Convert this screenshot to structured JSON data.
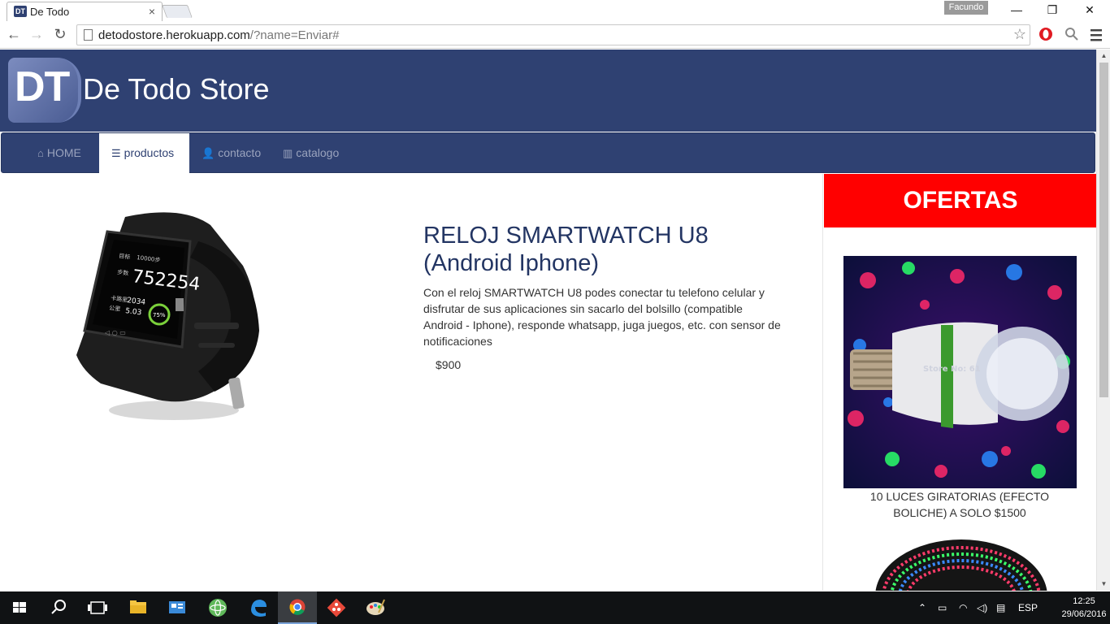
{
  "browser": {
    "tab_title": "De Todo",
    "tab_favicon": "DT",
    "tab_close": "×",
    "profile_name": "Facundo",
    "url_host": "detodostore.herokuapp.com",
    "url_path": "/?name=Enviar#",
    "window_controls": {
      "minimize": "—",
      "maximize": "❐",
      "close": "✕"
    }
  },
  "site": {
    "logo_text": "DT",
    "title": "De Todo Store",
    "nav": [
      {
        "label": "HOME",
        "icon": "home-icon",
        "active": false
      },
      {
        "label": "productos",
        "icon": "list-icon",
        "active": true
      },
      {
        "label": "contacto",
        "icon": "user-icon",
        "active": false
      },
      {
        "label": "catalogo",
        "icon": "barcode-icon",
        "active": false
      }
    ]
  },
  "product": {
    "title": "RELOJ SMARTWATCH U8 (Android Iphone)",
    "description": "Con el reloj SMARTWATCH U8 podes conectar tu telefono celular y disfrutar de sus aplicaciones sin sacarlo del bolsillo (compatible Android - Iphone), responde whatsapp, juga juegos, etc. con sensor de notificaciones",
    "price": "$900",
    "watch_screen": {
      "label1": "目标",
      "value1": "10000步",
      "label2": "步数",
      "steps": "752254",
      "label3": "卡路里",
      "value3": "2034",
      "label4": "公里",
      "value4": "5.03",
      "percent": "75%"
    }
  },
  "offers": {
    "heading": "OFERTAS",
    "items": [
      {
        "caption": "10 LUCES GIRATORIAS (EFECTO BOLICHE) A SOLO $1500",
        "watermark": "Store No: 61"
      }
    ]
  },
  "taskbar": {
    "language": "ESP",
    "time": "12:25",
    "date": "29/06/2016"
  }
}
